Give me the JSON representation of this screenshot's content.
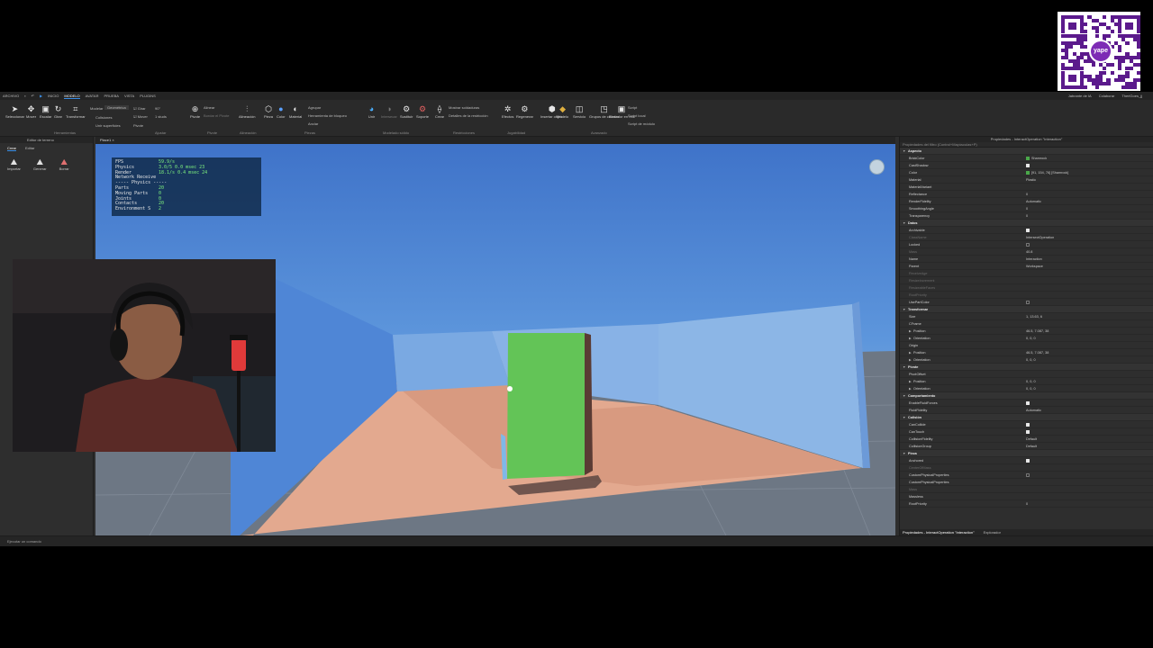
{
  "qr": {
    "brand_text": "yape"
  },
  "menubar": {
    "tabs": [
      {
        "label": "ARCHIVO",
        "active": false
      },
      {
        "label": "INICIO",
        "active": false
      },
      {
        "label": "MODELO",
        "active": true
      },
      {
        "label": "AVATAR",
        "active": false
      },
      {
        "label": "PRUEBA",
        "active": false
      },
      {
        "label": "VISTA",
        "active": false
      },
      {
        "label": "PLUGINS",
        "active": false
      }
    ],
    "right": [
      "Jabrante de IA",
      "Colaborar",
      "TheriGoes_jj"
    ]
  },
  "ribbon": {
    "tools": [
      "Seleccionar",
      "Mover",
      "Escalar",
      "Girar",
      "Transformar"
    ],
    "tools_group": "Herramientas",
    "snap": {
      "mode_label": "Modelar",
      "mode_value": "Geométrica",
      "rotate_label": "Girar",
      "rotate_value": "90°",
      "move_label": "Mover",
      "move_value": "1 studs",
      "collisions": "Colisiones",
      "join": "Unir superficies",
      "pivots_label": "Pivote",
      "pivot_btn": "Pivote",
      "adjust_group": "Ajustar",
      "pivot_opts": [
        "Alinear",
        "Bordar el Pivote"
      ]
    },
    "alignment": {
      "label": "Alineación",
      "group": "Alineación"
    },
    "parts": [
      "Pieza",
      "Color",
      "Material"
    ],
    "parts_opts": [
      "Agrupar",
      "Herramienta de bloqueo",
      "Anclar"
    ],
    "parts_group": "Piezas",
    "solid": [
      "Unir",
      "Intersecar"
    ],
    "solid_group": "Modelado sólido",
    "constraints": [
      "Sustituir",
      "Soporte",
      "Crear"
    ],
    "constraints_opts": [
      "Mostrar soldaduras",
      "Detalles de la restricción"
    ],
    "constraints_group": "Restricciones",
    "physics": [
      "Efectos",
      "Regenerar"
    ],
    "physics_group": "Jugabilidad",
    "advanced": [
      "Insertar objeto",
      "Modelo",
      "Servicio",
      "Grupos de colisión",
      "Borrador en red"
    ],
    "scripts": [
      "Script",
      "Script local",
      "Script de módulo"
    ],
    "advanced_group": "Avanzado"
  },
  "left_panel": {
    "title": "Editor de terreno",
    "tabs": [
      {
        "label": "Crear",
        "active": true
      },
      {
        "label": "Editar",
        "active": false
      }
    ],
    "tools": [
      "Importar",
      "Generar",
      "Borrar"
    ]
  },
  "viewport": {
    "tab_label": "Place1",
    "stats": [
      {
        "k": "FPS",
        "v": "59.9/s"
      },
      {
        "k": "Physics",
        "v": "3.0/5 0.0 msec 23"
      },
      {
        "k": "Render",
        "v": "18.1/s 0.4 msec 24"
      },
      {
        "k": "Network Receive",
        "v": ""
      },
      {
        "k": "----- Physics -----",
        "v": ""
      },
      {
        "k": "Parts",
        "v": "20"
      },
      {
        "k": "Moving Parts",
        "v": "0"
      },
      {
        "k": "Joints",
        "v": "0"
      },
      {
        "k": "Contacts",
        "v": "20"
      },
      {
        "k": "Environment S",
        "v": "2"
      }
    ]
  },
  "right_panel": {
    "title": "Propiedades - InteractOperation \"Interaction\"",
    "filter_placeholder": "Propiedades del filtro (Control+Mayúsculas+P)",
    "rows": [
      {
        "type": "section",
        "name": "Aspecto"
      },
      {
        "type": "prop",
        "name": "BrickColor",
        "val": "Shamrock",
        "swatch": "#4aa84a"
      },
      {
        "type": "prop",
        "name": "CastShadow",
        "check": true
      },
      {
        "type": "prop",
        "name": "Color",
        "val": "[91, 154, 76] [Shamrock]",
        "swatch": "#4aa84a"
      },
      {
        "type": "prop",
        "name": "Material",
        "val": "Plastic"
      },
      {
        "type": "prop",
        "name": "MaterialVariant",
        "val": ""
      },
      {
        "type": "prop",
        "name": "Reflectance",
        "val": "0"
      },
      {
        "type": "prop",
        "name": "RenderFidelity",
        "val": "Automatic"
      },
      {
        "type": "prop",
        "name": "SmoothingAngle",
        "val": "0"
      },
      {
        "type": "prop",
        "name": "Transparency",
        "val": "0"
      },
      {
        "type": "section",
        "name": "Datos"
      },
      {
        "type": "prop",
        "name": "Archivable",
        "check": true
      },
      {
        "type": "prop",
        "name": "ClassName",
        "val": "IntersectOperation",
        "dim": true
      },
      {
        "type": "prop",
        "name": "Locked",
        "check": false
      },
      {
        "type": "prop",
        "name": "Mass",
        "val": "40.8",
        "dim": true
      },
      {
        "type": "prop",
        "name": "Name",
        "val": "Interaction"
      },
      {
        "type": "prop",
        "name": "Parent",
        "val": "Workspace"
      },
      {
        "type": "prop",
        "name": "ReceiveAge",
        "val": "",
        "dim": true
      },
      {
        "type": "prop",
        "name": "ResizeIncrement",
        "val": "",
        "dim": true
      },
      {
        "type": "prop",
        "name": "ResizeableFaces",
        "val": "",
        "dim": true
      },
      {
        "type": "prop",
        "name": "RootPriority",
        "val": "",
        "dim": true
      },
      {
        "type": "prop",
        "name": "UsePartColor",
        "check": false
      },
      {
        "type": "section",
        "name": "Transformar"
      },
      {
        "type": "prop",
        "name": "Size",
        "val": "1, 13.63, 6"
      },
      {
        "type": "prop",
        "name": "CFrame",
        "val": ""
      },
      {
        "type": "sub",
        "name": "Position",
        "val": "46.5, 7.087, 38"
      },
      {
        "type": "sub",
        "name": "Orientation",
        "val": "0, 0, 0"
      },
      {
        "type": "prop",
        "name": "Origin",
        "val": ""
      },
      {
        "type": "sub",
        "name": "Position",
        "val": "46.5, 7.087, 38"
      },
      {
        "type": "sub",
        "name": "Orientation",
        "val": "0, 0, 0"
      },
      {
        "type": "section",
        "name": "Pivote"
      },
      {
        "type": "prop",
        "name": "PivotOffset",
        "val": ""
      },
      {
        "type": "sub",
        "name": "Position",
        "val": "0, 0, 0"
      },
      {
        "type": "sub",
        "name": "Orientation",
        "val": "0, 0, 0"
      },
      {
        "type": "section",
        "name": "Comportamiento"
      },
      {
        "type": "prop",
        "name": "EnableFluidForces",
        "check": true
      },
      {
        "type": "prop",
        "name": "FluidFidelity",
        "val": "Automatic"
      },
      {
        "type": "section",
        "name": "Colisión"
      },
      {
        "type": "prop",
        "name": "CanCollide",
        "check": true
      },
      {
        "type": "prop",
        "name": "CanTouch",
        "check": true
      },
      {
        "type": "prop",
        "name": "CollisionFidelity",
        "val": "Default"
      },
      {
        "type": "prop",
        "name": "CollisionGroup",
        "val": "Default"
      },
      {
        "type": "section",
        "name": "Pieza"
      },
      {
        "type": "prop",
        "name": "Anchored",
        "check": true
      },
      {
        "type": "prop",
        "name": "CenterOfMass",
        "val": "",
        "dim": true
      },
      {
        "type": "prop",
        "name": "CustomPhysicalProperties",
        "check": false
      },
      {
        "type": "prop",
        "name": "CustomPhysicalProperties",
        "val": ""
      },
      {
        "type": "prop",
        "name": "Mass",
        "val": "",
        "dim": true
      },
      {
        "type": "prop",
        "name": "Massless",
        "val": ""
      },
      {
        "type": "prop",
        "name": "RootPriority",
        "val": "0"
      }
    ],
    "bottom_tabs": [
      {
        "label": "Propiedades - InteractOperation \"Interaction\"",
        "active": true
      },
      {
        "label": "Explorador",
        "active": false
      }
    ]
  },
  "command_bar": {
    "placeholder": "Ejecutar un comando"
  },
  "colors": {
    "accent": "#3a8ee6",
    "sky": "#4d86d9",
    "wall": "#8cb6e6",
    "floor": "#e3a98f",
    "door": "#63c457",
    "stats_green": "#7ef07e"
  }
}
